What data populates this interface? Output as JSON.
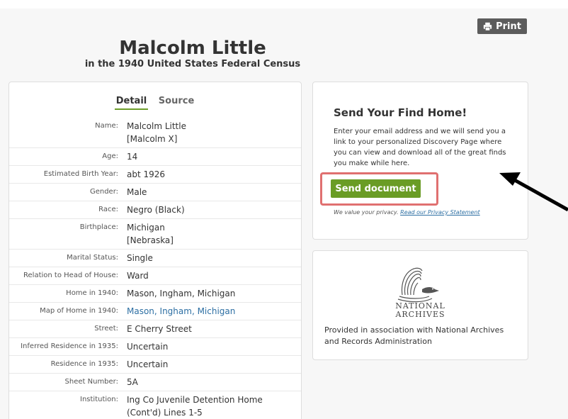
{
  "header": {
    "print_label": "Print",
    "title": "Malcolm Little",
    "subtitle": "in the 1940 United States Federal Census"
  },
  "tabs": [
    "Detail",
    "Source"
  ],
  "details": [
    {
      "label": "Name:",
      "value": "Malcolm Little",
      "value2": "[Malcolm X]"
    },
    {
      "label": "Age:",
      "value": "14"
    },
    {
      "label": "Estimated Birth Year:",
      "value": "abt 1926"
    },
    {
      "label": "Gender:",
      "value": "Male"
    },
    {
      "label": "Race:",
      "value": "Negro (Black)"
    },
    {
      "label": "Birthplace:",
      "value": "Michigan",
      "value2": "[Nebraska]"
    },
    {
      "label": "Marital Status:",
      "value": "Single"
    },
    {
      "label": "Relation to Head of House:",
      "value": "Ward"
    },
    {
      "label": "Home in 1940:",
      "value": "Mason, Ingham, Michigan"
    },
    {
      "label": "Map of Home in 1940:",
      "value": "Mason, Ingham, Michigan",
      "link": true
    },
    {
      "label": "Street:",
      "value": "E Cherry Street"
    },
    {
      "label": "Inferred Residence in 1935:",
      "value": "Uncertain"
    },
    {
      "label": "Residence in 1935:",
      "value": "Uncertain"
    },
    {
      "label": "Sheet Number:",
      "value": "5A"
    },
    {
      "label": "Institution:",
      "value": "Ing Co Juvenile Detention Home",
      "value2": "(Cont'd) Lines 1-5"
    }
  ],
  "send": {
    "title": "Send Your Find Home!",
    "body": "Enter your email address and we will send you a link to your personalized Discovery Page where you can view and download all of the great finds you make while here.",
    "button": "Send document",
    "privacy_text": "We value your privacy.",
    "privacy_link": "Read our Privacy Statement"
  },
  "archives": {
    "logo_line1": "NATIONAL",
    "logo_line2": "ARCHIVES",
    "caption": "Provided in association with National Archives and Records Administration"
  },
  "colors": {
    "accent_green": "#6a9c25",
    "highlight_red": "#e07070",
    "link_blue": "#2d6fa3"
  }
}
